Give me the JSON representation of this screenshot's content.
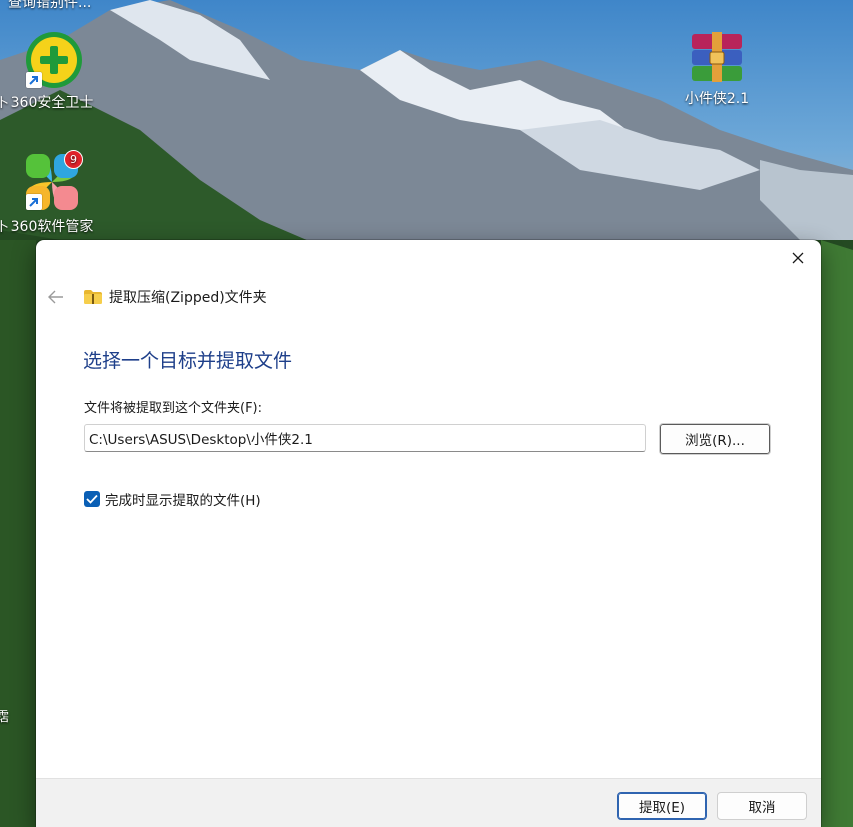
{
  "desktop": {
    "top_cut_label": "查询错别件...",
    "icons": [
      {
        "label": "360安全卫士"
      },
      {
        "label": "360软件管家",
        "badge": "9"
      },
      {
        "label": "小件侠2.1"
      }
    ]
  },
  "dialog": {
    "title": "提取压缩(Zipped)文件夹",
    "heading": "选择一个目标并提取文件",
    "field_label": "文件将被提取到这个文件夹(F):",
    "path_value": "C:\\Users\\ASUS\\Desktop\\小件侠2.1",
    "browse_label": "浏览(R)...",
    "checkbox_label": "完成时显示提取的文件(H)",
    "checkbox_checked": true,
    "extract_label": "提取(E)",
    "cancel_label": "取消",
    "accent_color": "#0a5fb5",
    "heading_color": "#1e3f8a"
  }
}
